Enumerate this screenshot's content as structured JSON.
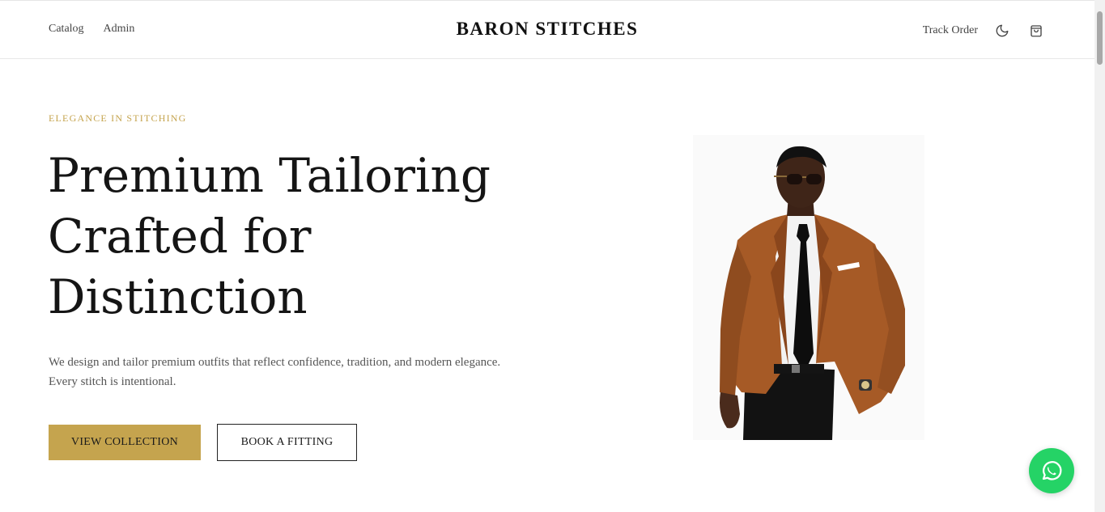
{
  "header": {
    "nav_left": [
      {
        "label": "Catalog"
      },
      {
        "label": "Admin"
      }
    ],
    "brand": "BARON STITCHES",
    "track_order_label": "Track Order",
    "theme_toggle_icon": "moon-icon",
    "cart_icon": "shopping-bag-icon"
  },
  "hero": {
    "eyebrow": "ELEGANCE IN STITCHING",
    "headline_line1": "Premium Tailoring",
    "headline_line2": "Crafted for",
    "headline_line3": "Distinction",
    "subtext": "We design and tailor premium outfits that reflect confidence, tradition, and modern elegance. Every stitch is intentional.",
    "primary_button": "VIEW COLLECTION",
    "secondary_button": "BOOK A FITTING",
    "image_subject": "man in brown suit jacket, white shirt, black tie and sunglasses"
  },
  "floating": {
    "whatsapp_icon": "whatsapp-icon"
  },
  "colors": {
    "accent_gold": "#c5a44e",
    "whatsapp_green": "#25d366",
    "text_dark": "#151515",
    "text_muted": "#555555"
  }
}
